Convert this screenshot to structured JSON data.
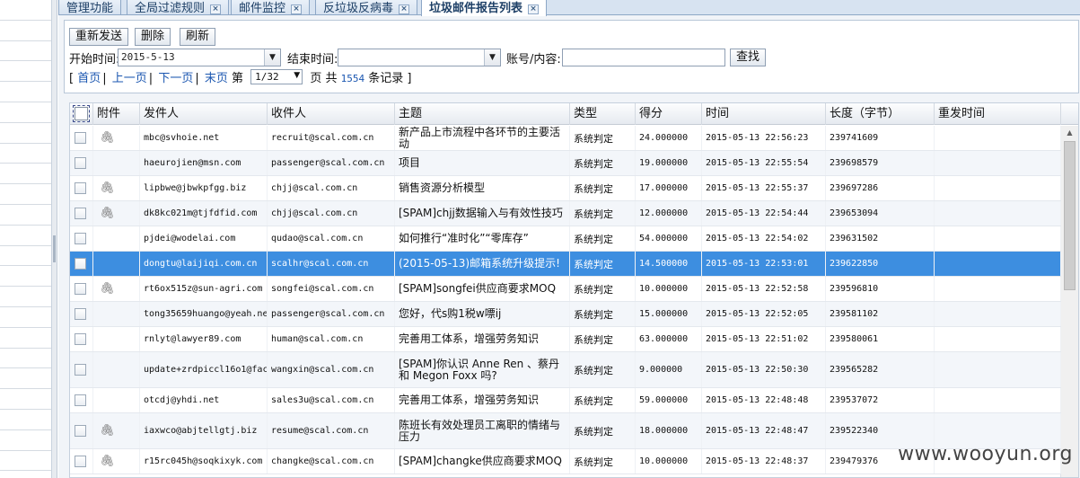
{
  "tabs": [
    {
      "label": "管理功能",
      "closable": false
    },
    {
      "label": "全局过滤规则",
      "closable": true
    },
    {
      "label": "邮件监控",
      "closable": true
    },
    {
      "label": "反垃圾反病毒",
      "closable": true
    },
    {
      "label": "垃圾邮件报告列表",
      "closable": true,
      "active": true
    }
  ],
  "toolbar": {
    "resend_label": "重新发送",
    "delete_label": "删除",
    "refresh_label": "刷新",
    "start_time_label": "开始时间:",
    "start_time_value": "2015-5-13",
    "end_time_label": "结束时间:",
    "end_time_value": "",
    "account_label": "账号/内容:",
    "account_value": "",
    "search_label": "查找"
  },
  "pager": {
    "open_bracket": "[",
    "first": "首页",
    "prev": "上一页",
    "next": "下一页",
    "last": "末页",
    "page_prefix": "第",
    "page_value": "1/32",
    "page_suffix": "页",
    "total_prefix": "共",
    "total_count": "1554",
    "total_suffix": "条记录",
    "close_bracket": "]"
  },
  "grid": {
    "columns": [
      "附件",
      "发件人",
      "收件人",
      "主题",
      "类型",
      "得分",
      "时间",
      "长度（字节）",
      "重发时间"
    ],
    "rows": [
      {
        "attach": true,
        "from": "mbc@svhoie.net",
        "to": "recruit@scal.com.cn",
        "subject": "新产品上市流程中各环节的主要活动",
        "type": "系统判定",
        "score": "24.000000",
        "time": "2015-05-13 22:56:23",
        "length": "239741609"
      },
      {
        "attach": false,
        "from": "haeurojien@msn.com",
        "to": "passenger@scal.com.cn",
        "subject": "项目",
        "type": "系统判定",
        "score": "19.000000",
        "time": "2015-05-13 22:55:54",
        "length": "239698579"
      },
      {
        "attach": true,
        "from": "lipbwe@jbwkpfgg.biz",
        "to": "chjj@scal.com.cn",
        "subject": "销售资源分析模型",
        "type": "系统判定",
        "score": "17.000000",
        "time": "2015-05-13 22:55:37",
        "length": "239697286"
      },
      {
        "attach": true,
        "from": "dk8kc021m@tjfdfid.com",
        "to": "chjj@scal.com.cn",
        "subject": "[SPAM]chjj数据输入与有效性技巧",
        "type": "系统判定",
        "score": "12.000000",
        "time": "2015-05-13 22:54:44",
        "length": "239653094"
      },
      {
        "attach": false,
        "from": "pjdei@wodelai.com",
        "to": "qudao@scal.com.cn",
        "subject": "如何推行“准时化”“零库存”",
        "type": "系统判定",
        "score": "54.000000",
        "time": "2015-05-13 22:54:02",
        "length": "239631502"
      },
      {
        "attach": false,
        "selected": true,
        "from": "dongtu@laijiqi.com.cn",
        "to": "scalhr@scal.com.cn",
        "subject": "(2015-05-13)邮箱系统升级提示!",
        "type": "系统判定",
        "score": "14.500000",
        "time": "2015-05-13 22:53:01",
        "length": "239622850"
      },
      {
        "attach": true,
        "from": "rt6ox515z@sun-agri.com",
        "to": "songfei@scal.com.cn",
        "subject": "[SPAM]songfei供应商要求MOQ",
        "type": "系统判定",
        "score": "10.000000",
        "time": "2015-05-13 22:52:58",
        "length": "239596810"
      },
      {
        "attach": false,
        "from": "tong35659huango@yeah.ne",
        "to": "passenger@scal.com.cn",
        "subject": "您好，代s购1税w嘌ij",
        "type": "系统判定",
        "score": "15.000000",
        "time": "2015-05-13 22:52:05",
        "length": "239581102"
      },
      {
        "attach": false,
        "from": "rnlyt@lawyer89.com",
        "to": "human@scal.com.cn",
        "subject": "完善用工体系，增强劳务知识",
        "type": "系统判定",
        "score": "63.000000",
        "time": "2015-05-13 22:51:02",
        "length": "239580061"
      },
      {
        "attach": false,
        "tall": true,
        "from": "update+zrdpiccl16o1@fac",
        "to": "wangxin@scal.com.cn",
        "subject": "[SPAM]你认识 Anne Ren 、蔡丹和 Megon Foxx 吗?",
        "type": "系统判定",
        "score": "9.000000",
        "time": "2015-05-13 22:50:30",
        "length": "239565282"
      },
      {
        "attach": false,
        "from": "otcdj@yhdi.net",
        "to": "sales3u@scal.com.cn",
        "subject": "完善用工体系，增强劳务知识",
        "type": "系统判定",
        "score": "59.000000",
        "time": "2015-05-13 22:48:48",
        "length": "239537072"
      },
      {
        "attach": true,
        "tall": true,
        "from": "iaxwco@abjtellgtj.biz",
        "to": "resume@scal.com.cn",
        "subject": "陈班长有效处理员工离职的情绪与压力",
        "type": "系统判定",
        "score": "18.000000",
        "time": "2015-05-13 22:48:47",
        "length": "239522340"
      },
      {
        "attach": true,
        "from": "r15rc045h@soqkixyk.com",
        "to": "changke@scal.com.cn",
        "subject": "[SPAM]changke供应商要求MOQ",
        "type": "系统判定",
        "score": "10.000000",
        "time": "2015-05-13 22:48:37",
        "length": "239479376"
      }
    ]
  },
  "watermark": "www.wooyun.org"
}
